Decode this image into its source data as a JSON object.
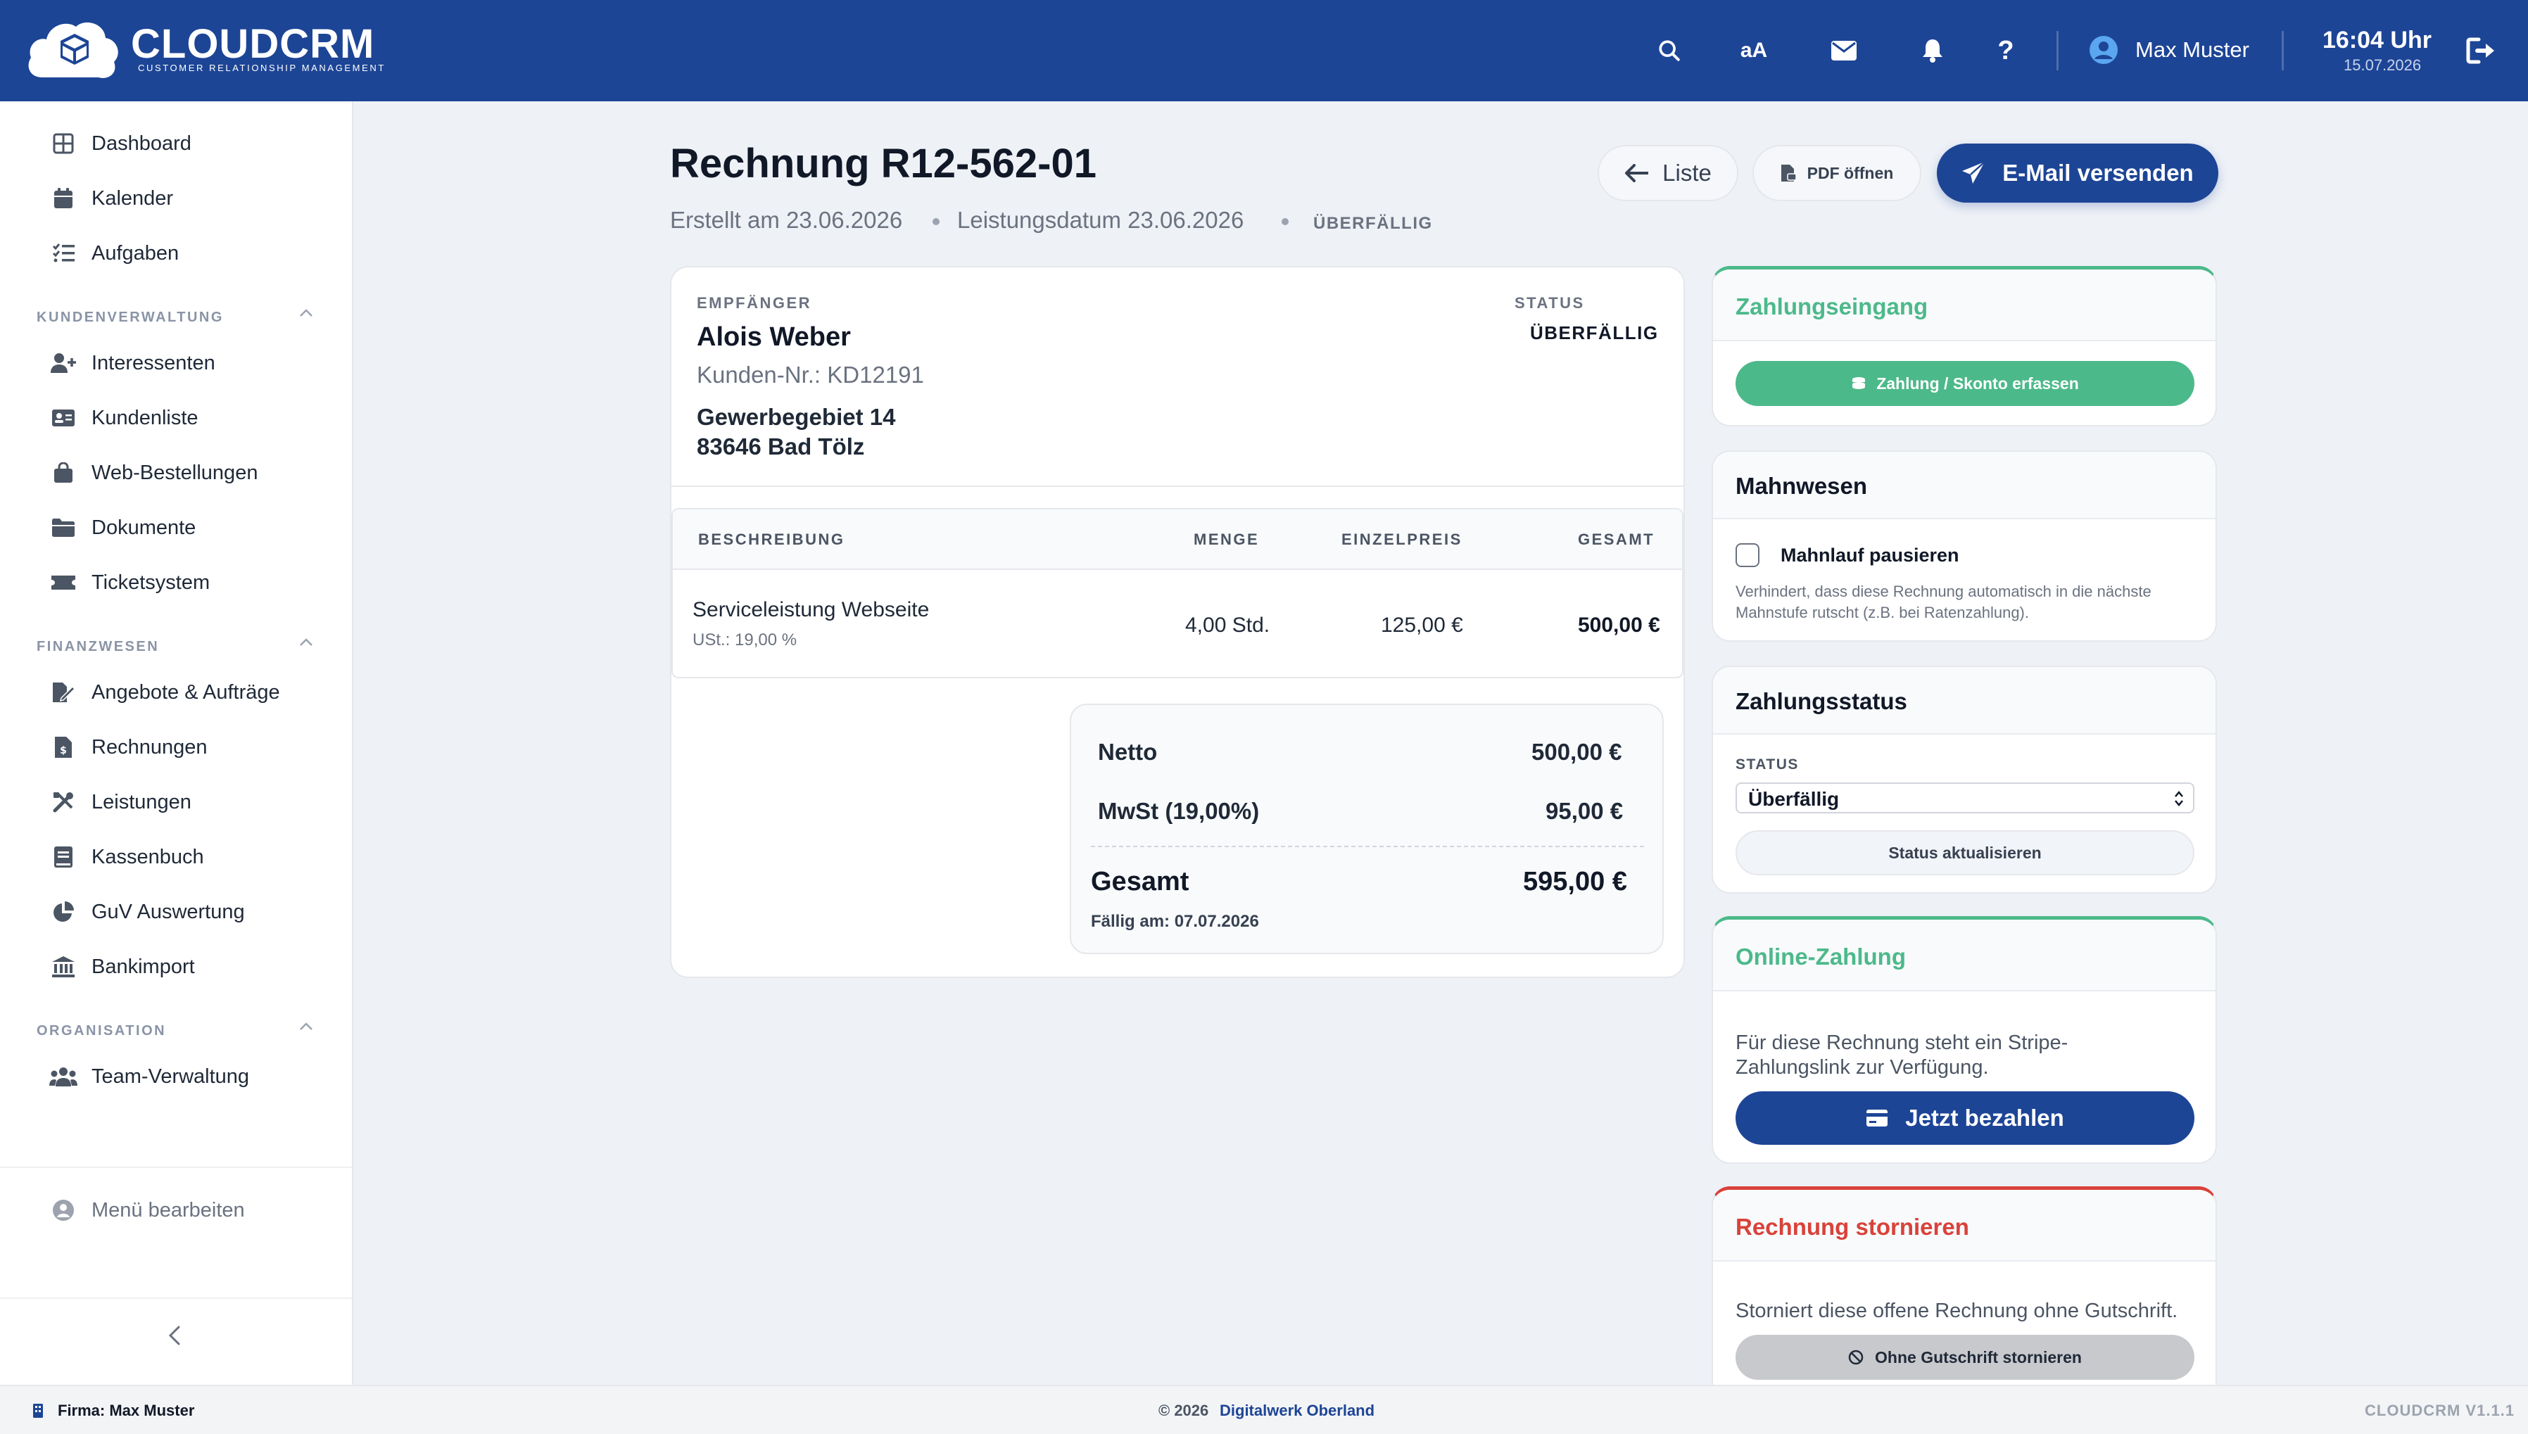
{
  "app": {
    "brand": "CLOUDCRM",
    "tagline": "CUSTOMER RELATIONSHIP MANAGEMENT",
    "user_name": "Max Muster",
    "time": "16:04 Uhr",
    "date": "15.07.2026",
    "font_size_label": "aA"
  },
  "colors": {
    "brand_blue": "#1d4596",
    "success_green": "#4cb98a",
    "danger_red": "#d9423a"
  },
  "sidebar": {
    "top_items": [
      {
        "label": "Dashboard",
        "icon": "dashboard-icon"
      },
      {
        "label": "Kalender",
        "icon": "calendar-icon"
      },
      {
        "label": "Aufgaben",
        "icon": "tasks-icon"
      }
    ],
    "sections": [
      {
        "title": "KUNDENVERWALTUNG",
        "items": [
          {
            "label": "Interessenten",
            "icon": "user-plus-icon"
          },
          {
            "label": "Kundenliste",
            "icon": "id-card-icon"
          },
          {
            "label": "Web-Bestellungen",
            "icon": "shopping-bag-icon"
          },
          {
            "label": "Dokumente",
            "icon": "folder-icon"
          },
          {
            "label": "Ticketsystem",
            "icon": "ticket-icon"
          }
        ]
      },
      {
        "title": "FINANZWESEN",
        "items": [
          {
            "label": "Angebote & Aufträge",
            "icon": "file-signature-icon"
          },
          {
            "label": "Rechnungen",
            "icon": "invoice-dollar-icon"
          },
          {
            "label": "Leistungen",
            "icon": "tools-icon"
          },
          {
            "label": "Kassenbuch",
            "icon": "book-icon"
          },
          {
            "label": "GuV Auswertung",
            "icon": "pie-chart-icon"
          },
          {
            "label": "Bankimport",
            "icon": "bank-icon"
          }
        ]
      },
      {
        "title": "ORGANISATION",
        "items": [
          {
            "label": "Team-Verwaltung",
            "icon": "users-icon"
          }
        ]
      }
    ],
    "edit_menu": "Menü bearbeiten"
  },
  "invoice": {
    "title": "Rechnung R12-562-01",
    "created": "Erstellt am 23.06.2026",
    "service_date": "Leistungsdatum 23.06.2026",
    "status_badge": "ÜBERFÄLLIG",
    "actions": {
      "list": "Liste",
      "pdf": "PDF öffnen",
      "email": "E-Mail versenden"
    },
    "recipient_caption": "EMPFÄNGER",
    "recipient_name": "Alois Weber",
    "customer_no": "Kunden-Nr.: KD12191",
    "street": "Gewerbegebiet 14",
    "city": "83646 Bad Tölz",
    "status_caption": "STATUS",
    "status_value": "ÜBERFÄLLIG",
    "columns": [
      "BESCHREIBUNG",
      "MENGE",
      "EINZELPREIS",
      "GESAMT"
    ],
    "items": [
      {
        "description": "Serviceleistung Webseite",
        "tax": "USt.: 19,00 %",
        "quantity": "4,00 Std.",
        "unit_price": "125,00 €",
        "total": "500,00 €"
      }
    ],
    "totals": {
      "net_label": "Netto",
      "net_value": "500,00 €",
      "vat_label": "MwSt (19,00%)",
      "vat_value": "95,00 €",
      "gross_label": "Gesamt",
      "gross_value": "595,00 €",
      "due": "Fällig am: 07.07.2026"
    }
  },
  "panels": {
    "payment_in": {
      "title": "Zahlungseingang",
      "button": "Zahlung / Skonto erfassen"
    },
    "dunning": {
      "title": "Mahnwesen",
      "checkbox_label": "Mahnlauf pausieren",
      "checked": false,
      "hint": "Verhindert, dass diese Rechnung automatisch in die nächste Mahnstufe rutscht (z.B. bei Ratenzahlung)."
    },
    "payment_status": {
      "title": "Zahlungsstatus",
      "caption": "STATUS",
      "selected": "Überfällig",
      "button": "Status aktualisieren"
    },
    "online_payment": {
      "title": "Online-Zahlung",
      "text": "Für diese Rechnung steht ein Stripe-Zahlungslink zur Verfügung.",
      "button": "Jetzt bezahlen"
    },
    "cancel": {
      "title": "Rechnung stornieren",
      "text": "Storniert diese offene Rechnung ohne Gutschrift.",
      "button": "Ohne Gutschrift stornieren"
    }
  },
  "footer": {
    "company": "Firma: Max Muster",
    "copyright": "© 2026",
    "copyright_link": "Digitalwerk Oberland",
    "version": "CLOUDCRM V1.1.1"
  }
}
